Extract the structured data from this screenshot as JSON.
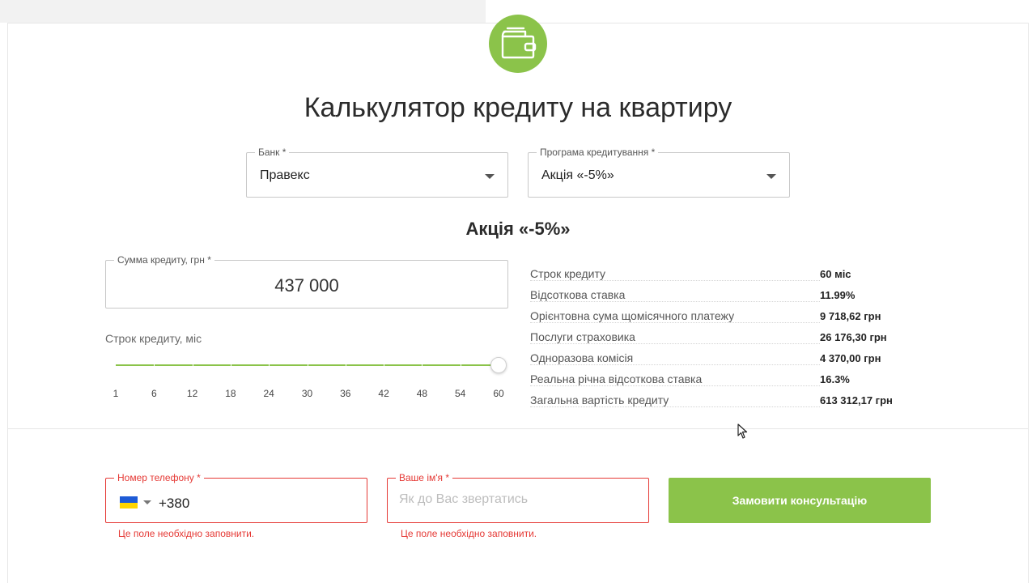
{
  "page": {
    "title": "Калькулятор кредиту на квартиру",
    "subtitle": "Акція «-5%»"
  },
  "form": {
    "bank": {
      "label": "Банк *",
      "value": "Правекс"
    },
    "program": {
      "label": "Програма кредитування *",
      "value": "Акція «-5%»"
    },
    "amount": {
      "label": "Сумма кредиту, грн *",
      "value": "437 000"
    },
    "term": {
      "label": "Строк кредиту, міс",
      "ticks": [
        "1",
        "6",
        "12",
        "18",
        "24",
        "30",
        "36",
        "42",
        "48",
        "54",
        "60"
      ],
      "selected": 60,
      "min": 1,
      "max": 60
    }
  },
  "details": [
    {
      "label": "Строк кредиту",
      "value": "60 міс"
    },
    {
      "label": "Відсоткова ставка",
      "value": "11.99%"
    },
    {
      "label": "Орієнтовна сума щомісячного платежу",
      "value": "9 718,62 грн"
    },
    {
      "label": "Послуги страховика",
      "value": "26 176,30 грн"
    },
    {
      "label": "Одноразова комісія",
      "value": "4 370,00 грн"
    },
    {
      "label": "Реальна річна відсоткова ставка",
      "value": "16.3%"
    },
    {
      "label": "Загальна вартість кредиту",
      "value": "613 312,17 грн"
    }
  ],
  "contact": {
    "phone": {
      "label": "Номер телефону *",
      "value": "+380",
      "error": "Це поле необхідно заповнити.",
      "flag": "ukraine-flag-icon"
    },
    "name": {
      "label": "Ваше ім'я *",
      "placeholder": "Як до Вас звертатись",
      "error": "Це поле необхідно заповнити."
    },
    "submit_label": "Замовити консультацію"
  },
  "colors": {
    "accent": "#8bc34a",
    "error": "#e53935"
  }
}
